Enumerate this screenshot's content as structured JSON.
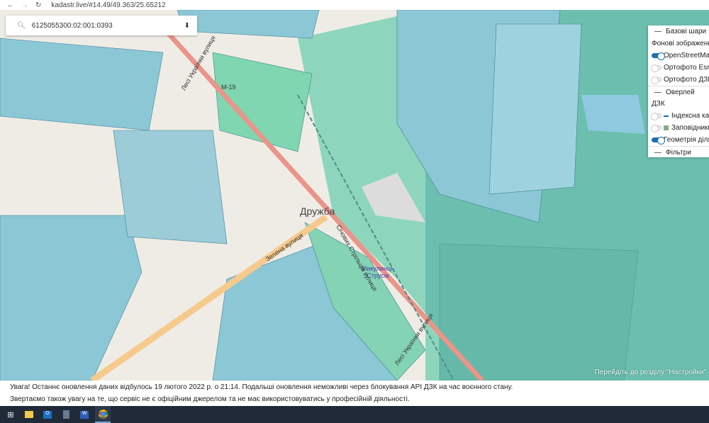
{
  "browser": {
    "url": "kadastr.live/#14.49/49.363/25.65212",
    "back_icon": "arrow-left-icon",
    "forward_icon": "arrow-right-icon",
    "reload_icon": "reload-icon"
  },
  "search": {
    "value": "6125055300:02:001:0393",
    "icon": "search-icon",
    "download_icon": "download-icon"
  },
  "map_labels": {
    "town": "Дружба",
    "station": "Микулинці-Струсів",
    "street1": "Зелена вулиця",
    "street2": "Лесі Українки вулиця",
    "street3": "Лесі Українки вулиця",
    "road": "М-19",
    "street4": "Січових Стрільців вулиця"
  },
  "layers": {
    "base_title": "Базові шари",
    "background_label": "Фонові зображення",
    "base_items": [
      {
        "label": "OpenStreetMap",
        "on": true
      },
      {
        "label": "Ортофото Esri",
        "on": false
      },
      {
        "label": "Ортофото ДЗК",
        "on": false
      }
    ],
    "overlay_title": "Оверлей",
    "dzk_label": "ДЗК",
    "overlay_items": [
      {
        "label": "Індексна карта",
        "on": false,
        "swatch": "#1f6fae"
      },
      {
        "label": "Заповідники",
        "on": false,
        "swatch": "#7fb07f"
      },
      {
        "label": "Геометрія ділянок",
        "on": true
      }
    ],
    "filters_title": "Фільтри"
  },
  "notice": {
    "line1": "Увага! Останнє оновлення даних відбулось 19 лютого 2022 р. о 21:14. Подальші оновлення неможливі через блокування API ДЗК на час воєнного стану.",
    "line2": "Звертаємо також увагу на те, що сервіс не є офіційним джерелом та не має використовуватись у професійній діяльності."
  },
  "watermark": "Перейдіть до розділу \"Настройки\"",
  "taskbar": [
    "windows-start-icon",
    "file-explorer-icon",
    "outlook-icon",
    "calculator-icon",
    "word-icon",
    "chrome-icon"
  ],
  "colors": {
    "parcel": "#8cc7d6",
    "forest": "#6cbfae",
    "green": "#7ed8b2",
    "road_orange": "#f6c98c",
    "road_red": "#e9958a"
  }
}
